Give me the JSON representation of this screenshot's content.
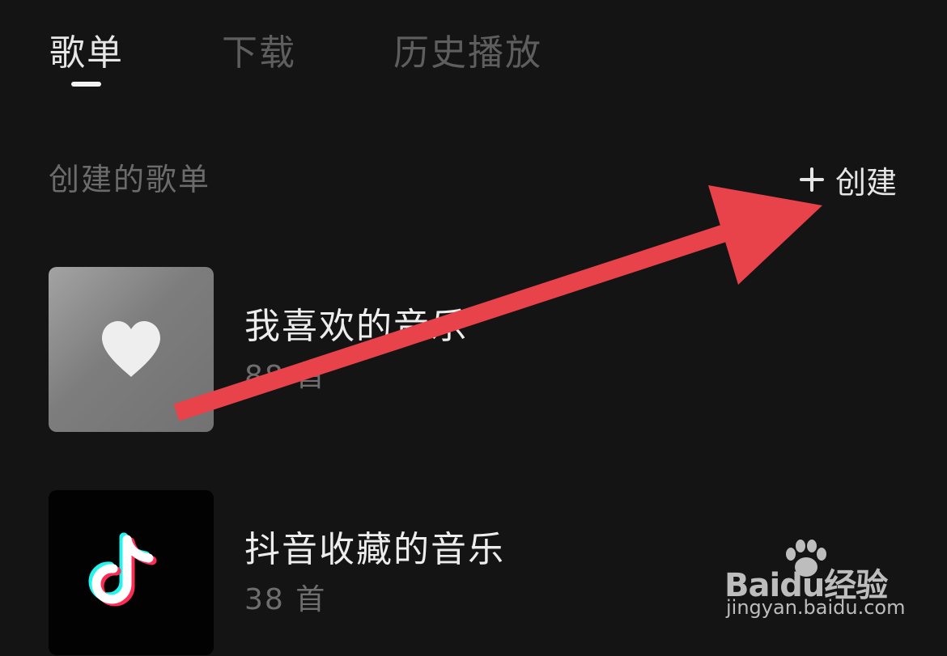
{
  "tabs": [
    {
      "label": "歌单",
      "active": true
    },
    {
      "label": "下载",
      "active": false
    },
    {
      "label": "历史播放",
      "active": false
    }
  ],
  "section": {
    "title": "创建的歌单",
    "create_label": "创建"
  },
  "playlists": [
    {
      "title": "我喜欢的音乐",
      "count": "88 首",
      "cover_icon": "heart-icon"
    },
    {
      "title": "抖音收藏的音乐",
      "count": "38 首",
      "cover_icon": "douyin-logo-icon"
    }
  ],
  "watermark": {
    "brand": "Baidu经验",
    "site": "jingyan.baidu.com"
  },
  "colors": {
    "background": "#141414",
    "arrow": "#e8424a",
    "active_tab": "#e6e6e6",
    "inactive_tab": "#5e5e5e"
  }
}
